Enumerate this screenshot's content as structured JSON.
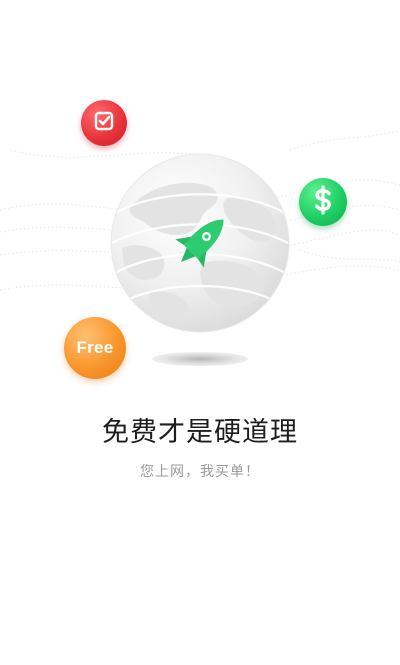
{
  "onboarding": {
    "headline": "免费才是硬道理",
    "subline": "您上网，我买单！",
    "badges": {
      "check_icon": "checkbox-icon",
      "dollar_icon": "dollar-icon",
      "free_label": "Free"
    },
    "illustration": {
      "globe_icon": "globe-icon",
      "rocket_icon": "rocket-icon"
    },
    "colors": {
      "check_badge": "#e8343b",
      "dollar_badge": "#1fcf63",
      "free_badge": "#f8962b",
      "rocket": "#2ecc71",
      "headline": "#1e1e1e",
      "subline": "#9a9a9a"
    }
  }
}
